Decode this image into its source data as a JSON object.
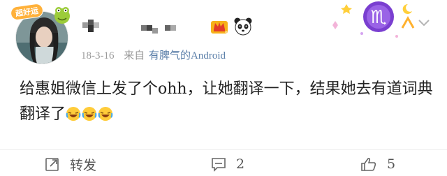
{
  "post": {
    "avatar_badge": "超好运",
    "meta": {
      "date": "18-3-16",
      "from_label": "来自",
      "source": "有脾气的Android"
    },
    "content": "给惠姐微信上发了个ohh，让她翻译一下，结果她去有道词典翻译了"
  },
  "actions": {
    "repost_label": "转发",
    "comment_count": "2",
    "like_count": "5"
  },
  "colors": {
    "meta_text": "#9a9a9a",
    "source_link": "#5a7ea8",
    "body_text": "#222222",
    "zodiac_purple": "#7a3fd0"
  },
  "icons": [
    "repost-icon",
    "comment-icon",
    "like-icon",
    "chevron-down-icon",
    "vip-crown-icon",
    "panda-icon",
    "laughing-crying-emoji",
    "scorpio-zodiac-icon"
  ]
}
